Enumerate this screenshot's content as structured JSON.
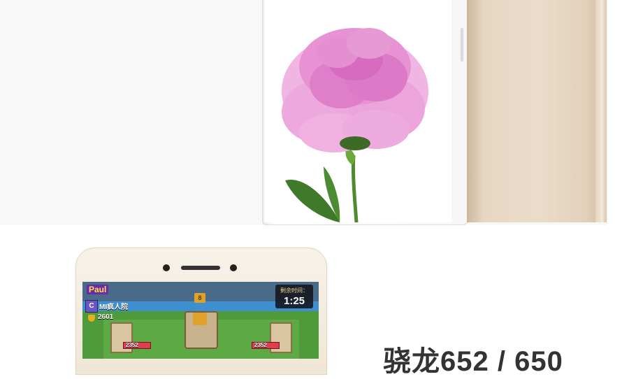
{
  "game": {
    "player_name": "Paul",
    "clan_letter": "C",
    "clan_name": "MI疯人院",
    "trophies": "2601",
    "crowns": "8",
    "timer_label": "剩余时间：",
    "timer_value": "1:25",
    "tower_hp_left": "2352",
    "tower_hp_right": "2352"
  },
  "spec": {
    "text": "骁龙652 / 650"
  },
  "colors": {
    "flower_pink": "#e58ad0",
    "phone_gold": "#e8d7c3",
    "stem_green": "#4f8a2e"
  },
  "icons": [
    "peony-flower-image",
    "camera-icon",
    "speaker-grille-icon",
    "trophy-icon",
    "crown-icon"
  ]
}
